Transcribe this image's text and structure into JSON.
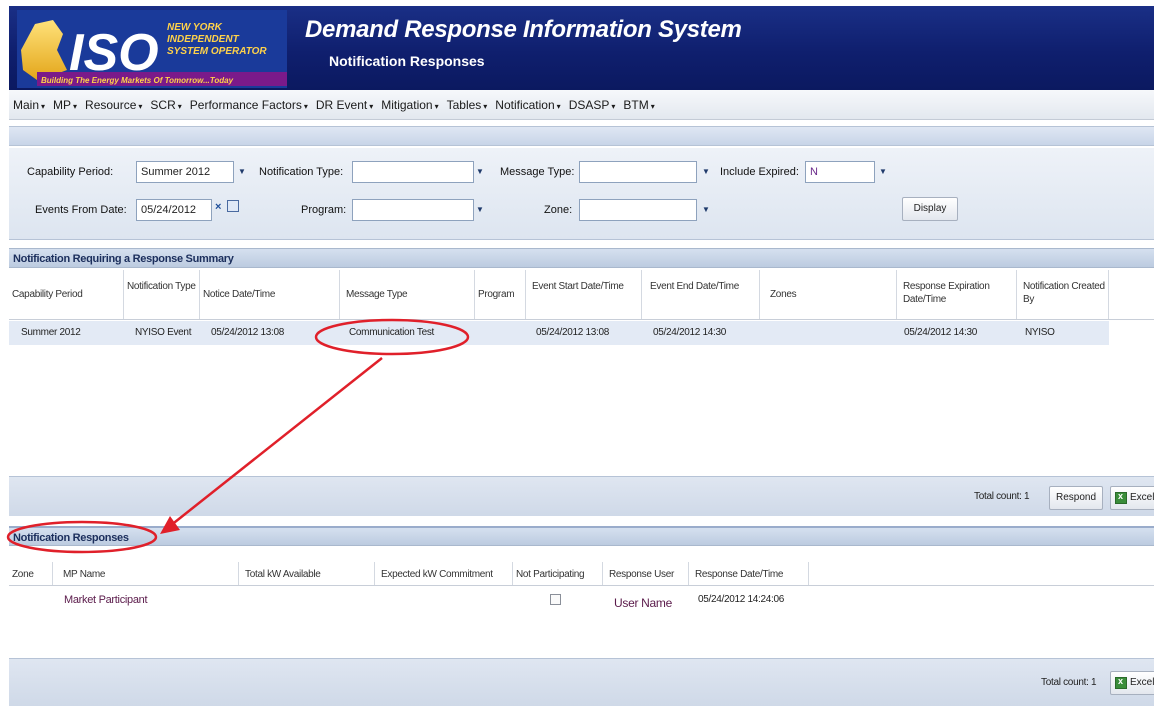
{
  "header": {
    "logo_text": "ISO",
    "logo_line1": "NEW YORK",
    "logo_line2": "INDEPENDENT",
    "logo_line3": "SYSTEM OPERATOR",
    "logo_tagline": "Building The Energy Markets Of Tomorrow...Today",
    "title": "Demand Response Information System",
    "subtitle": "Notification Responses"
  },
  "menu": [
    "Main",
    "MP",
    "Resource",
    "SCR",
    "Performance Factors",
    "DR Event",
    "Mitigation",
    "Tables",
    "Notification",
    "DSASP",
    "BTM"
  ],
  "filters": {
    "capability_period_label": "Capability Period:",
    "capability_period_value": "Summer 2012",
    "notification_type_label": "Notification Type:",
    "notification_type_value": "",
    "message_type_label": "Message Type:",
    "message_type_value": "",
    "include_expired_label": "Include Expired:",
    "include_expired_value": "N",
    "events_from_date_label": "Events From Date:",
    "events_from_date_value": "05/24/2012",
    "program_label": "Program:",
    "program_value": "",
    "zone_label": "Zone:",
    "zone_value": "",
    "display_button": "Display"
  },
  "summary": {
    "title": "Notification Requiring a Response Summary",
    "columns": [
      "Capability Period",
      "Notification Type",
      "Notice Date/Time",
      "Message Type",
      "Program",
      "Event Start Date/Time",
      "Event End Date/Time",
      "Zones",
      "Response Expiration Date/Time",
      "Notification Created By"
    ],
    "rows": [
      {
        "capability_period": "Summer 2012",
        "notification_type": "NYISO Event",
        "notice_datetime": "05/24/2012 13:08",
        "message_type": "Communication Test",
        "program": "",
        "event_start": "05/24/2012 13:08",
        "event_end": "05/24/2012 14:30",
        "zones": "",
        "response_expiration": "05/24/2012 14:30",
        "created_by": "NYISO"
      }
    ],
    "total_count": "Total count: 1",
    "respond_button": "Respond",
    "excel_button": "Excel"
  },
  "responses": {
    "title": "Notification Responses",
    "columns": [
      "Zone",
      "MP Name",
      "Total kW Available",
      "Expected kW Commitment",
      "Not Participating",
      "Response User",
      "Response Date/Time"
    ],
    "rows": [
      {
        "zone": "",
        "mp_name": "Market Participant",
        "total_kw": "",
        "expected_kw": "",
        "not_participating": false,
        "response_user": "User Name",
        "response_datetime": "05/24/2012 14:24:06"
      }
    ],
    "total_count": "Total count: 1",
    "excel_button": "Excel"
  },
  "colors": {
    "header_bg": "#12236f",
    "annotation": "#e0202a",
    "link_text": "#5a1a4a"
  }
}
